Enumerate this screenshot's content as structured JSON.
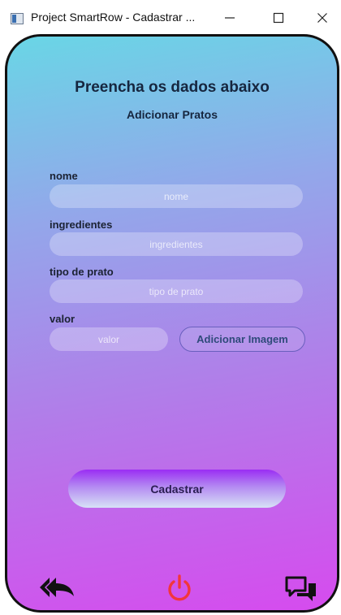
{
  "window": {
    "title": "Project SmartRow - Cadastrar ...",
    "minimize_glyph": "—",
    "maximize_glyph": "☐",
    "close_glyph": "✕"
  },
  "form": {
    "heading": "Preencha os dados abaixo",
    "subheading": "Adicionar Pratos",
    "fields": {
      "nome": {
        "label": "nome",
        "placeholder": "nome",
        "value": ""
      },
      "ingredientes": {
        "label": "ingredientes",
        "placeholder": "ingredientes",
        "value": ""
      },
      "tipo": {
        "label": "tipo de prato",
        "placeholder": "tipo de prato",
        "value": ""
      },
      "valor": {
        "label": "valor",
        "placeholder": "valor",
        "value": ""
      }
    },
    "add_image_label": "Adicionar Imagem",
    "submit_label": "Cadastrar"
  },
  "nav": {
    "back_icon": "back-arrow-icon",
    "power_icon": "power-icon",
    "chat_icon": "chat-icon"
  },
  "colors": {
    "gradient_top": "#69d6e6",
    "gradient_bottom": "#d64bee",
    "power_red": "#f2363c",
    "text_dark": "#16263f"
  }
}
